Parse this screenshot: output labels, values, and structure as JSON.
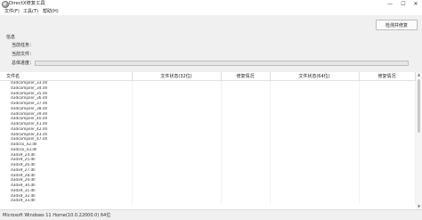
{
  "window": {
    "title": "DirectX修复工具",
    "minimize_glyph": "—",
    "maximize_glyph": "☐",
    "close_glyph": "✕"
  },
  "menu": {
    "items": [
      {
        "label": "文件(F)"
      },
      {
        "label": "工具(T)"
      },
      {
        "label": "帮助(H)"
      }
    ]
  },
  "toolbar": {
    "check_button_label": "检测并修复"
  },
  "info": {
    "title": "信息",
    "current_task_label": "当前任务：",
    "current_file_label": "当前文件：",
    "total_progress_label": "总体进度：",
    "total_progress": 0
  },
  "table": {
    "headers": [
      "文件名",
      "文件状态(32位)",
      "修复情况",
      "文件状态(64位)",
      "修复情况"
    ],
    "rows": [
      "d3dcompiler_33.dll",
      "d3dcompiler_34.dll",
      "d3dcompiler_35.dll",
      "d3dcompiler_36.dll",
      "d3dcompiler_37.dll",
      "d3dcompiler_38.dll",
      "d3dcompiler_39.dll",
      "d3dcompiler_40.dll",
      "d3dcompiler_41.dll",
      "d3dcompiler_42.dll",
      "d3dcompiler_43.dll",
      "d3dcompiler_47.dll",
      "d3dcsx_42.dll",
      "d3dcsx_43.dll",
      "d3dx9_24.dll",
      "d3dx9_25.dll",
      "d3dx9_26.dll",
      "d3dx9_27.dll",
      "d3dx9_28.dll",
      "d3dx9_29.dll",
      "d3dx9_30.dll",
      "d3dx9_31.dll",
      "d3dx9_32.dll",
      "d3dx9_33.dll"
    ]
  },
  "statusbar": {
    "text": "Microsoft Windows 11 Home(10.0.22000.0) 64位"
  },
  "colors": {
    "progress": "#06b025",
    "chrome_bg": "#f0f0f0"
  }
}
